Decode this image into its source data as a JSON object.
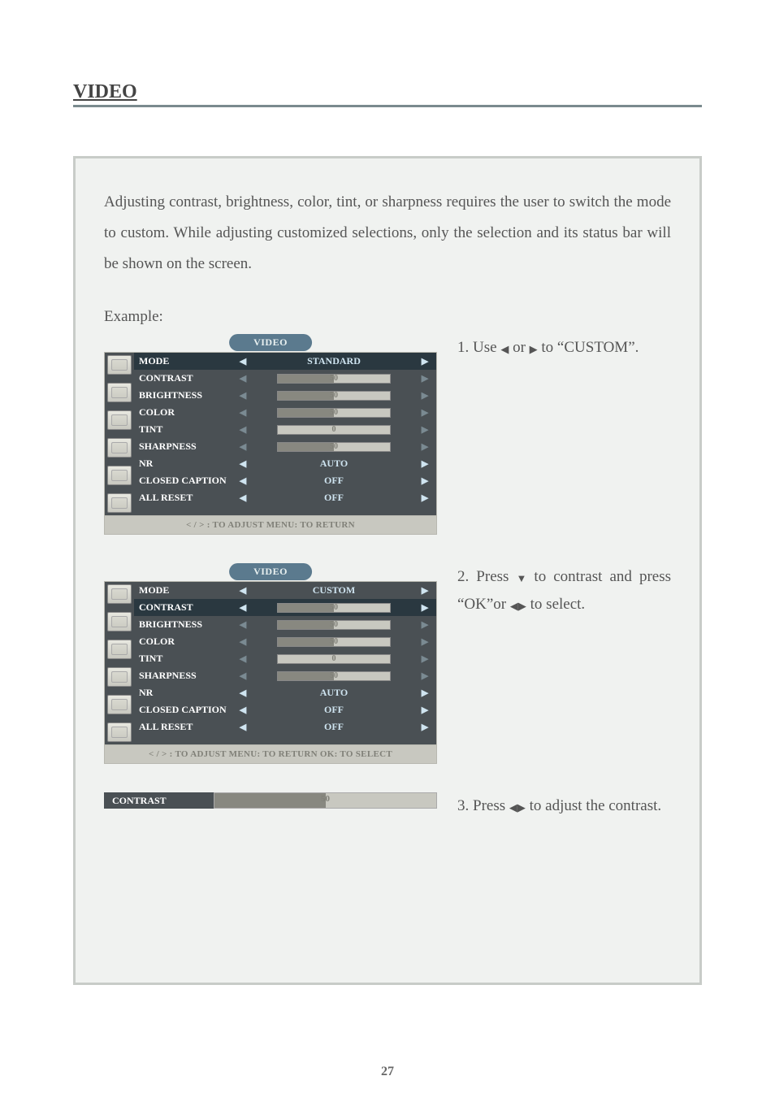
{
  "section_title": "VIDEO",
  "page_number": "27",
  "intro": "Adjusting contrast, brightness, color, tint, or sharpness requires the user to switch the mode to custom.  While adjusting customized selections, only the selection and its status bar will be shown on the screen.",
  "example_label": "Example:",
  "steps": {
    "s1": {
      "pre": "1. Use ",
      "mid": " or ",
      "tail": " to “CUSTOM”."
    },
    "s2": {
      "pre": "2. Press ",
      "mid": " to contrast and press “OK”or ",
      "tail": " to select."
    },
    "s3": {
      "pre": "3. Press ",
      "tail": " to adjust the contrast."
    }
  },
  "osd_tab": "VIDEO",
  "osd1": {
    "rows": [
      {
        "label": "MODE",
        "type": "text",
        "value": "STANDARD",
        "highlight": true
      },
      {
        "label": "CONTRAST",
        "type": "slider",
        "value": "50",
        "dim": true
      },
      {
        "label": "BRIGHTNESS",
        "type": "slider",
        "value": "50",
        "dim": true
      },
      {
        "label": "COLOR",
        "type": "slider",
        "value": "50",
        "dim": true
      },
      {
        "label": "TINT",
        "type": "slider",
        "value": "0",
        "center": true,
        "dim": true
      },
      {
        "label": "SHARPNESS",
        "type": "slider",
        "value": "50",
        "dim": true
      },
      {
        "label": "NR",
        "type": "text",
        "value": "AUTO"
      },
      {
        "label": "CLOSED CAPTION",
        "type": "text",
        "value": "OFF"
      },
      {
        "label": "ALL RESET",
        "type": "text",
        "value": "OFF"
      }
    ],
    "footer": "< / > : TO ADJUST   MENU: TO RETURN"
  },
  "osd2": {
    "rows": [
      {
        "label": "MODE",
        "type": "text",
        "value": "CUSTOM"
      },
      {
        "label": "CONTRAST",
        "type": "slider",
        "value": "50",
        "highlight": true
      },
      {
        "label": "BRIGHTNESS",
        "type": "slider",
        "value": "50",
        "dim": true
      },
      {
        "label": "COLOR",
        "type": "slider",
        "value": "50",
        "dim": true
      },
      {
        "label": "TINT",
        "type": "slider",
        "value": "0",
        "center": true,
        "dim": true
      },
      {
        "label": "SHARPNESS",
        "type": "slider",
        "value": "50",
        "dim": true
      },
      {
        "label": "NR",
        "type": "text",
        "value": "AUTO"
      },
      {
        "label": "CLOSED CAPTION",
        "type": "text",
        "value": "OFF"
      },
      {
        "label": "ALL RESET",
        "type": "text",
        "value": "OFF"
      }
    ],
    "footer": "< / > : TO ADJUST   MENU: TO RETURN   OK: TO SELECT"
  },
  "contrast_bar": {
    "label": "CONTRAST",
    "value": "50"
  }
}
